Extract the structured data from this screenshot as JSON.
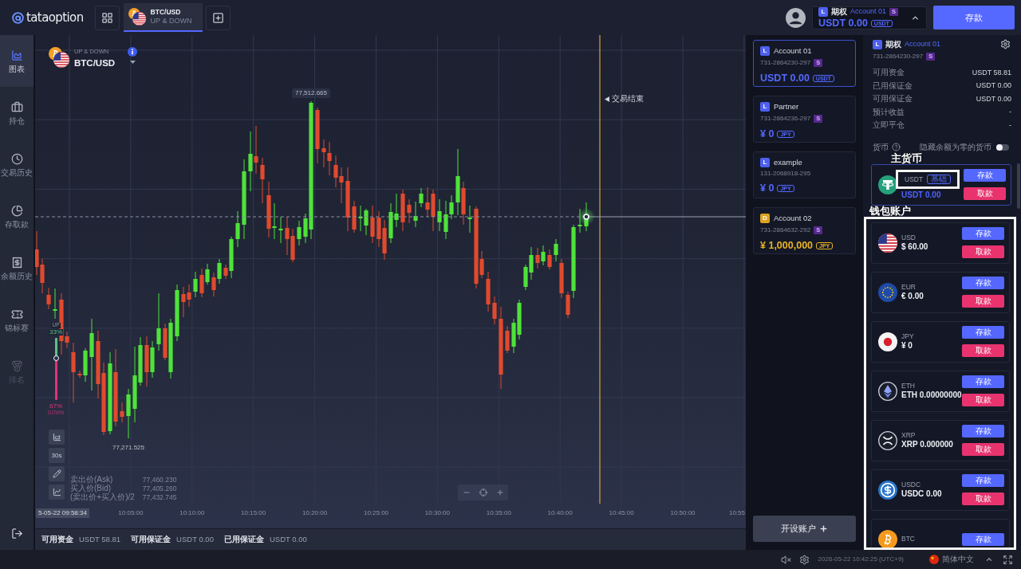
{
  "top_bar": {
    "logo": "tataoption",
    "tabs": [
      {
        "pair": "BTC/USD",
        "mode": "UP & DOWN",
        "selected": true
      }
    ],
    "account": {
      "badge": "L",
      "kind": "live",
      "type": "期权",
      "name": "Account 01",
      "tier": "S",
      "balance": "USDT 0.00",
      "currency": "USDT",
      "expanded": true
    },
    "deposit": "存款"
  },
  "sidebar": {
    "items": [
      {
        "label": "图表",
        "selected": true,
        "disabled": false
      },
      {
        "label": "持仓",
        "selected": false,
        "disabled": false
      },
      {
        "label": "交易历史",
        "selected": false,
        "disabled": false
      },
      {
        "label": "存取款",
        "selected": false,
        "disabled": false
      },
      {
        "label": "余额历史",
        "selected": false,
        "disabled": false
      },
      {
        "label": "锦标赛",
        "selected": false,
        "disabled": false
      },
      {
        "label": "排名",
        "selected": false,
        "disabled": true
      }
    ]
  },
  "chart": {
    "mode": "UP & DOWN",
    "pair": "BTC/USD",
    "high": "77,512.665",
    "low": "77,271.525",
    "expiry": "交易结束",
    "sentiment": {
      "up_label": "UP",
      "up": "33%",
      "down": "67%",
      "down_label": "DOWN",
      "level": 0.33
    },
    "interval": "30s",
    "quotes": [
      {
        "label": "卖出价(Ask)",
        "value": "77,460.230"
      },
      {
        "label": "买入价(Bid)",
        "value": "77,405.260"
      },
      {
        "label": "(卖出价+买入价)/2",
        "value": "77,432.745"
      }
    ],
    "start_time": "5-05-22 09:58:34",
    "time_ticks": [
      "10:05:00",
      "10:10:00",
      "10:15:00",
      "10:20:00",
      "10:25:00",
      "10:30:00",
      "10:35:00",
      "10:40:00",
      "10:45:00",
      "10:50:00",
      "10:55"
    ]
  },
  "balance_bar": [
    {
      "label": "可用资金",
      "value": "USDT 58.81"
    },
    {
      "label": "可用保证金",
      "value": "USDT 0.00"
    },
    {
      "label": "已用保证金",
      "value": "USDT 0.00"
    }
  ],
  "accounts": {
    "items": [
      {
        "badge": "L",
        "kind": "live",
        "name": "Account 01",
        "number": "731-2864230-297",
        "tier": "S",
        "balance": "USDT 0.00",
        "currency": "USDT",
        "selected": true
      },
      {
        "badge": "L",
        "kind": "live",
        "name": "Partner",
        "number": "731-2864236-297",
        "tier": "S",
        "balance": "¥ 0",
        "currency": "JPY",
        "selected": false
      },
      {
        "badge": "L",
        "kind": "live",
        "name": "example",
        "number": "131-2068918-295",
        "balance": "¥ 0",
        "currency": "JPY",
        "selected": false
      },
      {
        "badge": "D",
        "kind": "demo",
        "name": "Account 02",
        "number": "731-2864632-292",
        "tier": "S",
        "balance": "¥ 1,000,000",
        "currency": "JPY",
        "selected": false
      }
    ],
    "open_button": "开设账户"
  },
  "account_panel": {
    "badge": "L",
    "kind": "live",
    "type": "期权",
    "name": "Account 01",
    "number": "731-2864230-297",
    "tier": "S",
    "stats": [
      {
        "label": "可用资金",
        "value": "USDT 58.81"
      },
      {
        "label": "已用保证金",
        "value": "USDT 0.00"
      },
      {
        "label": "可用保证金",
        "value": "USDT 0.00"
      },
      {
        "label": "预计收益",
        "value": "-"
      },
      {
        "label": "立即平仓",
        "value": "-"
      }
    ],
    "currencies_label": "货币",
    "hide_zero": {
      "label": "隐藏余额为零的货币",
      "on": false
    },
    "primary": {
      "annotation": "主货币",
      "code": "USDT",
      "tag": "基础",
      "balance": "USDT 0.00",
      "deposit": "存款",
      "withdraw": "取款"
    },
    "wallets": {
      "annotation": "钱包账户",
      "items": [
        {
          "code": "USD",
          "balance": "$ 60.00",
          "deposit": "存款",
          "withdraw": "取款"
        },
        {
          "code": "EUR",
          "balance": "€ 0.00",
          "deposit": "存款",
          "withdraw": "取款"
        },
        {
          "code": "JPY",
          "balance": "¥ 0",
          "deposit": "存款",
          "withdraw": "取款"
        },
        {
          "code": "ETH",
          "balance": "ETH 0.00000000",
          "deposit": "存款",
          "withdraw": "取款"
        },
        {
          "code": "XRP",
          "balance": "XRP 0.000000",
          "deposit": "存款",
          "withdraw": "取款"
        },
        {
          "code": "USDC",
          "balance": "USDC 0.00",
          "deposit": "存款",
          "withdraw": "取款"
        },
        {
          "code": "BTC",
          "deposit": "存款"
        }
      ]
    }
  },
  "status_bar": {
    "muted": true,
    "time": "2026-05-22 10:42:25 (UTC+9)",
    "language": "简体中文"
  }
}
